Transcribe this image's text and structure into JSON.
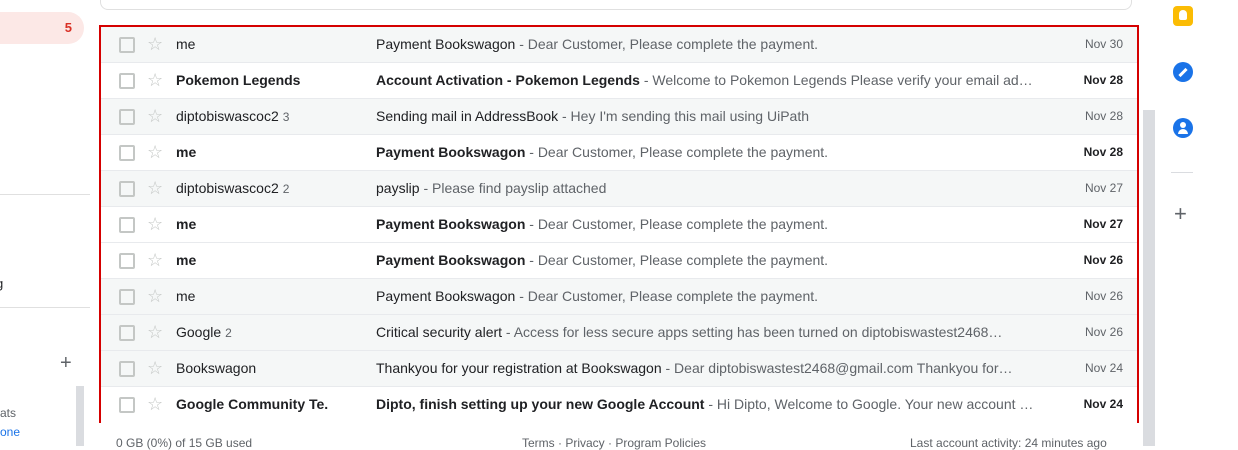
{
  "sidebar": {
    "inbox_count": "5",
    "fragment_label": "g",
    "add_label_icon": "plus-icon",
    "fragment_chats": "ats",
    "fragment_link": "one"
  },
  "emails": [
    {
      "sender": "me",
      "count": "",
      "subject": "Payment Bookswagon",
      "snippet": " - Dear Customer, Please complete the payment.",
      "date": "Nov 30",
      "unread": false
    },
    {
      "sender": "Pokemon Legends",
      "count": "",
      "subject": "Account Activation - Pokemon Legends",
      "snippet": " - Welcome to Pokemon Legends Please verify your email ad…",
      "date": "Nov 28",
      "unread": true
    },
    {
      "sender": "diptobiswascoc2",
      "count": "3",
      "subject": "Sending mail in AddressBook",
      "snippet": " - Hey I'm sending this mail using UiPath",
      "date": "Nov 28",
      "unread": false
    },
    {
      "sender": "me",
      "count": "",
      "subject": "Payment Bookswagon",
      "snippet": " - Dear Customer, Please complete the payment.",
      "date": "Nov 28",
      "unread": true
    },
    {
      "sender": "diptobiswascoc2",
      "count": "2",
      "subject": "payslip",
      "snippet": " - Please find payslip attached",
      "date": "Nov 27",
      "unread": false
    },
    {
      "sender": "me",
      "count": "",
      "subject": "Payment Bookswagon",
      "snippet": " - Dear Customer, Please complete the payment.",
      "date": "Nov 27",
      "unread": true
    },
    {
      "sender": "me",
      "count": "",
      "subject": "Payment Bookswagon",
      "snippet": " - Dear Customer, Please complete the payment.",
      "date": "Nov 26",
      "unread": true
    },
    {
      "sender": "me",
      "count": "",
      "subject": "Payment Bookswagon",
      "snippet": " - Dear Customer, Please complete the payment.",
      "date": "Nov 26",
      "unread": false
    },
    {
      "sender": "Google",
      "count": "2",
      "subject": "Critical security alert",
      "snippet": " - Access for less secure apps setting has been turned on diptobiswastest2468…",
      "date": "Nov 26",
      "unread": false
    },
    {
      "sender": "Bookswagon",
      "count": "",
      "subject": "Thankyou for your registration at Bookswagon",
      "snippet": " - Dear diptobiswastest2468@gmail.com Thankyou for…",
      "date": "Nov 24",
      "unread": false
    },
    {
      "sender": "Google Community Te.",
      "count": "",
      "subject": "Dipto, finish setting up your new Google Account",
      "snippet": " - Hi Dipto, Welcome to Google. Your new account …",
      "date": "Nov 24",
      "unread": true
    }
  ],
  "footer": {
    "storage": "0 GB (0%) of 15 GB used",
    "links": "Terms · Privacy · Program Policies",
    "activity": "Last account activity: 24 minutes ago"
  },
  "right_panel": {
    "icons": [
      "keep-icon",
      "tasks-icon",
      "contacts-icon",
      "plus-icon"
    ]
  },
  "colors": {
    "highlight_border": "#d50000",
    "inbox_badge": "#d93025",
    "accent_blue": "#1a73e8",
    "keep_yellow": "#fbbc04"
  }
}
